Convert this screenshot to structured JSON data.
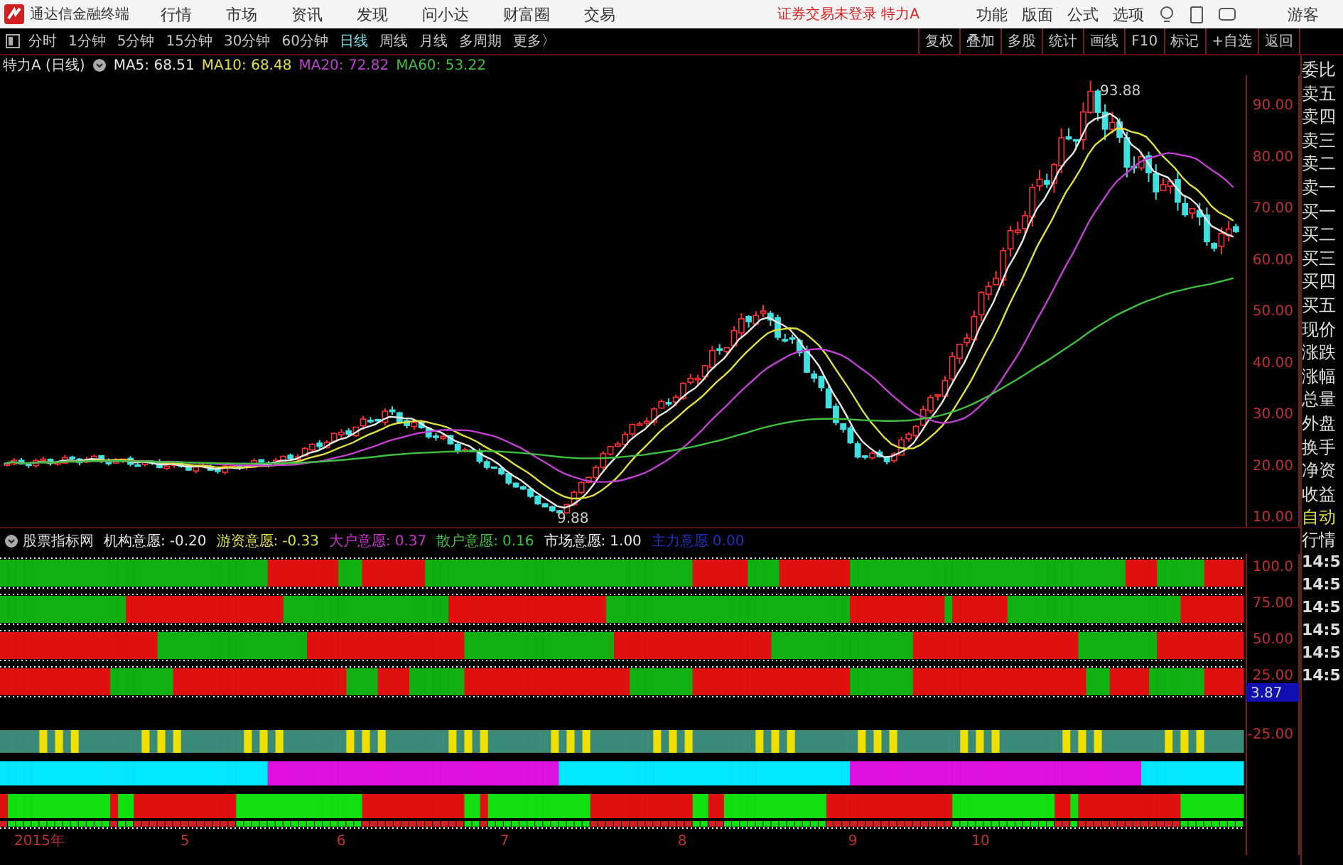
{
  "app_title": "通达信金融终端",
  "menu": [
    "行情",
    "市场",
    "资讯",
    "发现",
    "问小达",
    "财富圈",
    "交易"
  ],
  "login_status": "证券交易未登录  特力A",
  "right_menu": [
    "功能",
    "版面",
    "公式",
    "选项"
  ],
  "user": "游客",
  "periods": [
    {
      "label": "分时",
      "selected": false
    },
    {
      "label": "1分钟",
      "selected": false
    },
    {
      "label": "5分钟",
      "selected": false
    },
    {
      "label": "15分钟",
      "selected": false
    },
    {
      "label": "30分钟",
      "selected": false
    },
    {
      "label": "60分钟",
      "selected": false
    },
    {
      "label": "日线",
      "selected": true
    },
    {
      "label": "周线",
      "selected": false
    },
    {
      "label": "月线",
      "selected": false
    },
    {
      "label": "多周期",
      "selected": false
    },
    {
      "label": "更多〉",
      "selected": false
    }
  ],
  "tools": [
    "复权",
    "叠加",
    "多股",
    "统计",
    "画线",
    "F10",
    "标记",
    "+自选",
    "返回"
  ],
  "stock_label": "特力A (日线)",
  "ma": [
    {
      "label": "MA5: 68.51",
      "color": "#e8e8e8"
    },
    {
      "label": "MA10: 68.48",
      "color": "#e0e040"
    },
    {
      "label": "MA20: 72.82",
      "color": "#c040d0"
    },
    {
      "label": "MA60: 53.22",
      "color": "#40c040"
    }
  ],
  "price_axis": [
    "90.00",
    "80.00",
    "70.00",
    "60.00",
    "50.00",
    "40.00",
    "30.00",
    "20.00",
    "10.00"
  ],
  "high_mark": "93.88",
  "low_mark": "9.88",
  "quote_labels": [
    "委比",
    "卖五",
    "卖四",
    "卖三",
    "卖二",
    "卖一",
    "买一",
    "买二",
    "买三",
    "买四",
    "买五",
    "现价",
    "涨跌",
    "涨幅",
    "总量",
    "外盘",
    "换手",
    "净资",
    "收益"
  ],
  "quote_tabs": [
    "自动",
    "行情"
  ],
  "times": [
    "14:5",
    "14:5",
    "14:5",
    "14:5",
    "14:5",
    "14:5"
  ],
  "indicator_name": "股票指标网",
  "indicator_values": [
    {
      "label": "机构意愿:",
      "value": "-0.20",
      "color": "#e8e8e8"
    },
    {
      "label": "游资意愿:",
      "value": "-0.33",
      "color": "#e0e040"
    },
    {
      "label": "大户意愿:",
      "value": "0.37",
      "color": "#d030d0"
    },
    {
      "label": "散户意愿:",
      "value": "0.16",
      "color": "#40c040"
    },
    {
      "label": "市场意愿:",
      "value": "1.00",
      "color": "#e8e8e8"
    },
    {
      "label": "主力意愿",
      "value": "0.00",
      "color": "#2030c0"
    }
  ],
  "indicator_axis": [
    "100.0",
    "75.00",
    "50.00",
    "25.00"
  ],
  "indicator_current": "3.87",
  "indicator_axis_low": "-25.00",
  "dates": [
    "2015年",
    "5",
    "6",
    "7",
    "8",
    "9",
    "10"
  ]
}
